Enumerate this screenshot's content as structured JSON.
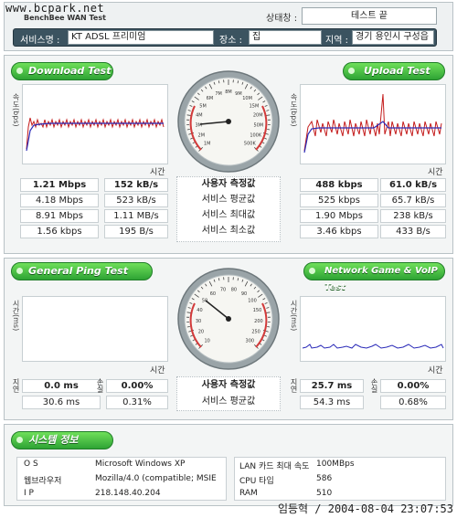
{
  "header": {
    "watermark": "www.bcpark.net",
    "app_name": "BenchBee WAN Test",
    "status_label": "상태창 :",
    "status_value": "테스트 끝",
    "service_label": "서비스명 :",
    "service_value": "KT ADSL 프리미엄",
    "place_label": "장소 :",
    "place_value": "집",
    "region_label": "지역 :",
    "region_value": "경기 용인시 구성읍"
  },
  "speed": {
    "download_title": "Download Test",
    "upload_title": "Upload Test",
    "y_axis_label": "속도(bps)",
    "x_axis_label": "시간",
    "rows": [
      {
        "label": "사용자 측정값",
        "dl_bps": "1.21 Mbps",
        "dl_Bps": "152 kB/s",
        "ul_bps": "488 kbps",
        "ul_Bps": "61.0 kB/s"
      },
      {
        "label": "서비스 평균값",
        "dl_bps": "4.18 Mbps",
        "dl_Bps": "523 kB/s",
        "ul_bps": "525 kbps",
        "ul_Bps": "65.7 kB/s"
      },
      {
        "label": "서비스 최대값",
        "dl_bps": "8.91 Mbps",
        "dl_Bps": "1.11 MB/s",
        "ul_bps": "1.90 Mbps",
        "ul_Bps": "238 kB/s"
      },
      {
        "label": "서비스 최소값",
        "dl_bps": "1.56 kbps",
        "dl_Bps": "195 B/s",
        "ul_bps": "3.46 kbps",
        "ul_Bps": "433 B/s"
      }
    ],
    "gauge_ticks": [
      "1M",
      "2M",
      "3M",
      "4M",
      "5M",
      "6M",
      "7M",
      "8M",
      "9M",
      "10M",
      "15M",
      "20M",
      "50M",
      "100K",
      "500K"
    ]
  },
  "ping": {
    "ping_title": "General Ping Test",
    "game_title": "Network Game & VoIP Test",
    "y_axis_label": "시간(ms)",
    "x_axis_label": "시간",
    "gauge_ticks": [
      "10",
      "20",
      "30",
      "40",
      "50",
      "60",
      "70",
      "80",
      "90",
      "100",
      "150",
      "200",
      "250",
      "300"
    ],
    "latency_label": "지연",
    "loss_label": "손실",
    "rows": [
      {
        "label": "사용자 측정값",
        "ping_ms": "0.0 ms",
        "ping_loss": "0.00%",
        "game_ms": "25.7 ms",
        "game_loss": "0.00%"
      },
      {
        "label": "서비스 평균값",
        "ping_ms": "30.6 ms",
        "ping_loss": "0.31%",
        "game_ms": "54.3 ms",
        "game_loss": "0.68%"
      }
    ]
  },
  "system": {
    "title": "시스템 정보",
    "os_label": "O S",
    "os_value": "Microsoft Windows XP",
    "browser_label": "웹브라우저",
    "browser_value": "Mozilla/4.0 (compatible; MSIE",
    "ip_label": "I P",
    "ip_value": "218.148.40.204",
    "lan_label": "LAN 카드 최대 속도",
    "lan_value": "100MBps",
    "cpu_label": "CPU 타입",
    "cpu_value": "586",
    "ram_label": "RAM",
    "ram_value": "510"
  },
  "footer": {
    "stamp": "임등혁 / 2004-08-04 23:07:53"
  }
}
